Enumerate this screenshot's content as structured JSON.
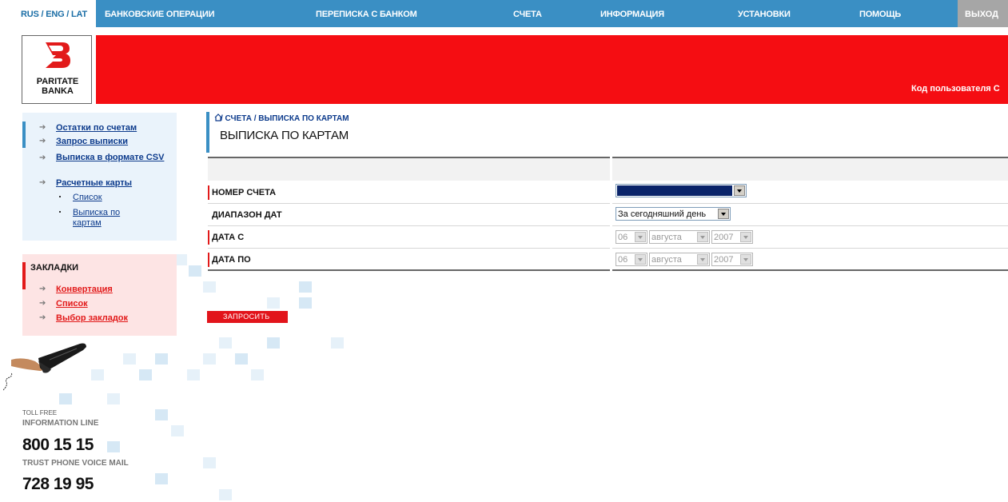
{
  "languages": "RUS / ENG / LAT",
  "nav": {
    "items": [
      "БАНКОВСКИЕ ОПЕРАЦИИ",
      "ПЕРЕПИСКА С БАНКОМ",
      "СЧЕТА",
      "ИНФОРМАЦИЯ",
      "УСТАНОВКИ",
      "ПОМОЩЬ"
    ],
    "exit": "ВЫХОД"
  },
  "logo": {
    "line1": "PARITATE",
    "line2": "BANKA"
  },
  "header": {
    "user_code": "Код пользователя С"
  },
  "sidebar": {
    "items": [
      "Остатки по счетам",
      "Запрос выписки",
      "Выписка в формате CSV",
      "Расчетные карты"
    ],
    "subitems": [
      "Список",
      "Выписка по картам"
    ]
  },
  "bookmarks": {
    "title": "ЗАКЛАДКИ",
    "items": [
      "Конвертация",
      "Список",
      "Выбор закладок"
    ]
  },
  "contact": {
    "toll_free": "TOLL FREE",
    "info_line": "INFORMATION LINE",
    "info_phone": "800 15 15",
    "voice_mail": "TRUST PHONE VOICE MAIL",
    "voice_phone": "728 19 95"
  },
  "breadcrumb": "/ СЧЕТА / ВЫПИСКА ПО КАРТАМ",
  "page_title": "ВЫПИСКА ПО КАРТАМ",
  "form": {
    "account_label": "НОМЕР СЧЕТА",
    "range_label": "ДИАПАЗОН ДАТ",
    "range_value": "За сегодняшний день",
    "from_label": "ДАТА С",
    "to_label": "ДАТА ПО",
    "day": "06",
    "month": "августа",
    "year": "2007",
    "submit": "ЗАПРОСИТЬ"
  },
  "colors": {
    "nav_blue": "#3a8fc4",
    "brand_red": "#f50d12",
    "link_navy": "#0d3b8c"
  }
}
